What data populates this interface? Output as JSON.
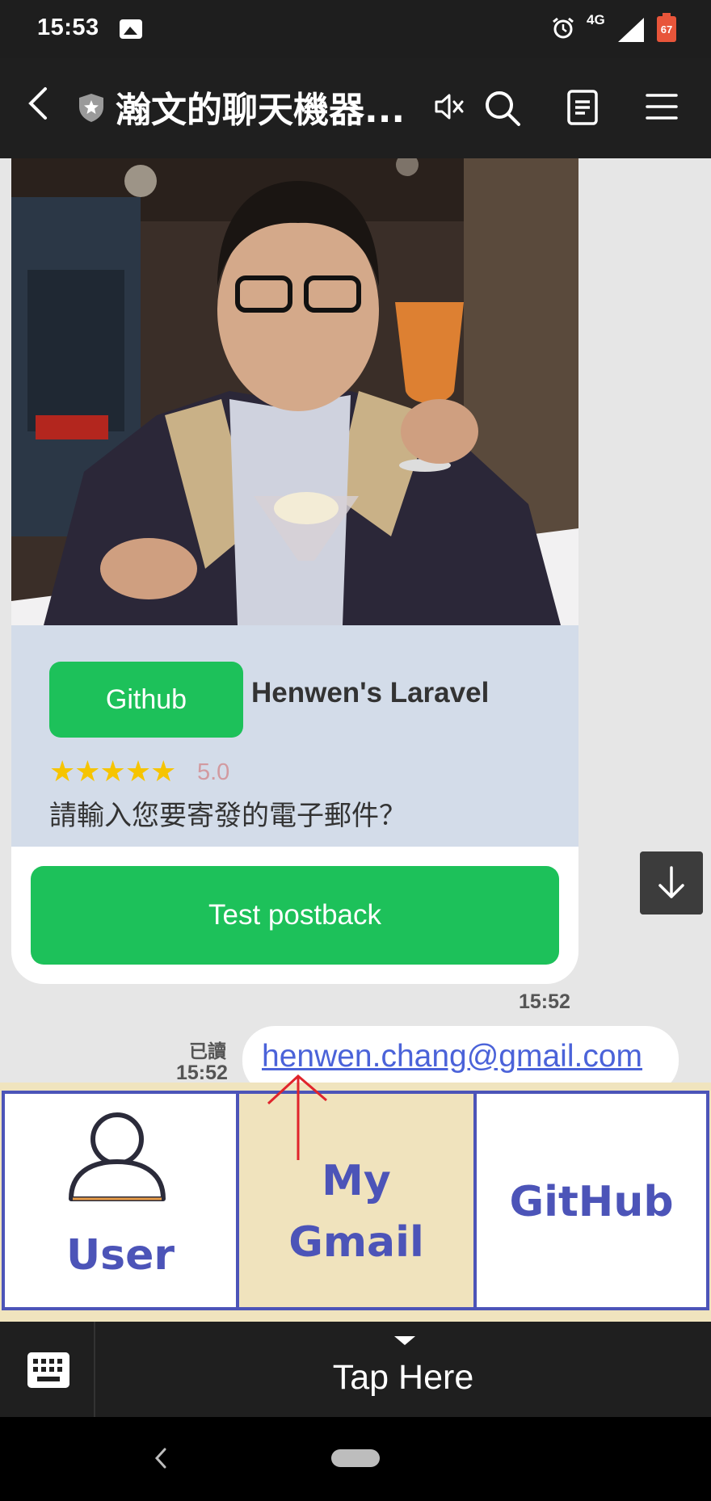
{
  "status_bar": {
    "time": "15:53",
    "network": "4G",
    "battery": "67"
  },
  "header": {
    "title": "瀚文的聊天機器..."
  },
  "card": {
    "tag_label": "Github",
    "heading": "Henwen's Laravel",
    "stars": "★★★★★",
    "rating": "5.0",
    "question": "請輸入您要寄發的電子郵件？",
    "button_label": "Test postback",
    "time": "15:52"
  },
  "message": {
    "read_label": "已讀",
    "read_time": "15:52",
    "text": "henwen.chang@gmail.com"
  },
  "rich_menu": {
    "items": [
      {
        "label": "User"
      },
      {
        "label": "My\nGmail"
      },
      {
        "label": "GitHub"
      }
    ]
  },
  "bottom_bar": {
    "tap_label": "Tap Here"
  },
  "colors": {
    "line_green": "#1dc15a",
    "menu_blue": "#4c54b8",
    "menu_highlight": "#f0e3bd"
  }
}
